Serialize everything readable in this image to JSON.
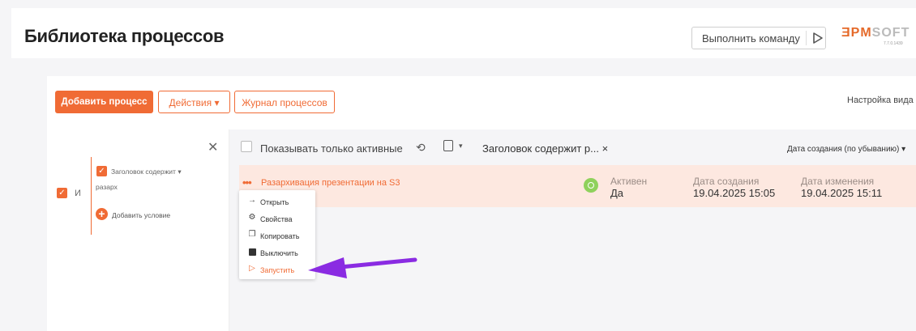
{
  "header": {
    "title": "Библиотека процессов",
    "command_label": "Выполнить команду",
    "logo_part1": "ƎPM",
    "logo_part2": "SOFT",
    "version": "7.7.0.1439"
  },
  "toolbar": {
    "add_label": "Добавить процесс",
    "actions_label": "Действия ▾",
    "journal_label": "Журнал процессов",
    "view_settings": "Настройка вида"
  },
  "filter": {
    "and_label": "И",
    "condition_label": "Заголовок содержит ▾",
    "condition_value": "разарх",
    "add_condition_label": "Добавить условие"
  },
  "list": {
    "active_only_label": "Показывать только активные",
    "search_chip": "Заголовок содержит р... ×",
    "sort_label": "Дата создания (по убыванию) ▾",
    "rows": [
      {
        "title": "Разархивация презентации на S3",
        "active_header": "Активен",
        "active_value": "Да",
        "created_header": "Дата создания",
        "created_value": "19.04.2025 15:05",
        "modified_header": "Дата изменения",
        "modified_value": "19.04.2025 15:11"
      }
    ]
  },
  "context_menu": {
    "items": [
      {
        "label": "Открыть",
        "icon": "arrow-right-icon"
      },
      {
        "label": "Свойства",
        "icon": "gear-icon"
      },
      {
        "label": "Копировать",
        "icon": "copy-icon"
      },
      {
        "label": "Выключить",
        "icon": "stop-icon"
      },
      {
        "label": "Запустить",
        "icon": "play-icon"
      }
    ]
  },
  "colors": {
    "accent": "#f06b35",
    "annotation_arrow": "#8a2be2",
    "row_highlight": "#fde8e0"
  }
}
